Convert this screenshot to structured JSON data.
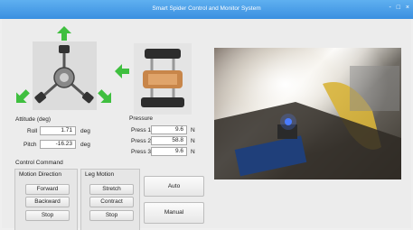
{
  "window": {
    "title": "Smart Spider Control and Monitor System",
    "controls": "- □ ×"
  },
  "attitude": {
    "label": "Attitude (deg)",
    "roll_label": "Roll",
    "roll_value": "1.71",
    "pitch_label": "Pitch",
    "pitch_value": "-16.23",
    "unit": "deg"
  },
  "pressure": {
    "label": "Pressure",
    "rows": [
      {
        "label": "Press 1",
        "value": "9.6",
        "unit": "N"
      },
      {
        "label": "Press 2",
        "value": "58.8",
        "unit": "N"
      },
      {
        "label": "Press 3",
        "value": "9.6",
        "unit": "N"
      }
    ]
  },
  "control": {
    "label": "Control Command",
    "motion": {
      "label": "Motion Direction",
      "buttons": [
        "Forward",
        "Backward",
        "Stop"
      ]
    },
    "leg": {
      "label": "Leg Motion",
      "buttons": [
        "Stretch",
        "Contract",
        "Stop"
      ]
    },
    "auto_label": "Auto",
    "manual_label": "Manual"
  },
  "icons": {
    "arrow_color": "#3fbf3f"
  }
}
